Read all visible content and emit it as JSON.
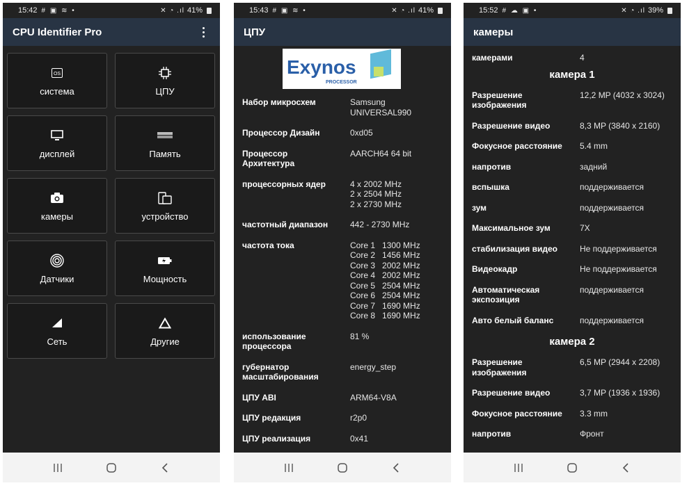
{
  "screen1": {
    "status": {
      "time": "15:42",
      "icons": "# ▣ ≋ •",
      "right_icons": "✕ ◔ .ıl",
      "battery": "41%"
    },
    "title": "CPU Identifier Pro",
    "tiles": [
      {
        "label": "система",
        "icon": "os-icon"
      },
      {
        "label": "ЦПУ",
        "icon": "cpu-icon"
      },
      {
        "label": "дисплей",
        "icon": "monitor-icon"
      },
      {
        "label": "Память",
        "icon": "memory-icon"
      },
      {
        "label": "камеры",
        "icon": "camera-icon"
      },
      {
        "label": "устройство",
        "icon": "device-icon"
      },
      {
        "label": "Датчики",
        "icon": "sensor-icon"
      },
      {
        "label": "Мощность",
        "icon": "battery-icon"
      },
      {
        "label": "Сеть",
        "icon": "signal-icon"
      },
      {
        "label": "Другие",
        "icon": "triangle-icon"
      }
    ]
  },
  "screen2": {
    "status": {
      "time": "15:43",
      "icons": "# ▣ ≋ •",
      "right_icons": "✕ ◔ .ıl",
      "battery": "41%"
    },
    "title": "ЦПУ",
    "logo": {
      "brand": "Exynos",
      "sub": "PROCESSOR"
    },
    "rows": [
      {
        "k": "Набор микросхем",
        "v": "Samsung\nUNIVERSAL990"
      },
      {
        "k": "Процессор Дизайн",
        "v": "0xd05"
      },
      {
        "k": "Процессор\nАрхитектура",
        "v": "AARCH64 64 bit"
      },
      {
        "k": "процессорных ядер",
        "v": "4 x 2002 MHz\n2 x 2504 MHz\n2 x 2730 MHz"
      },
      {
        "k": "частотный диапазон",
        "v": "442 - 2730 MHz"
      },
      {
        "k": "частота тока",
        "v": "Core 1   1300 MHz\nCore 2   1456 MHz\nCore 3   2002 MHz\nCore 4   2002 MHz\nCore 5   2504 MHz\nCore 6   2504 MHz\nCore 7   1690 MHz\nCore 8   1690 MHz"
      },
      {
        "k": "использование\nпроцессора",
        "v": "81 %"
      },
      {
        "k": "губернатор\nмасштабирования",
        "v": "energy_step"
      },
      {
        "k": "ЦПУ ABI",
        "v": "ARM64-V8A"
      },
      {
        "k": "ЦПУ редакция",
        "v": "r2p0"
      },
      {
        "k": "ЦПУ реализация",
        "v": "0x41"
      }
    ]
  },
  "screen3": {
    "status": {
      "time": "15:52",
      "icons": "# ☁ ▣ •",
      "right_icons": "✕ ◔ .ıl",
      "battery": "39%"
    },
    "title": "камеры",
    "count_row": {
      "k": "камерами",
      "v": "4"
    },
    "camera1_title": "камера 1",
    "camera1": [
      {
        "k": "Разрешение\nизображения",
        "v": "12,2 MP (4032 x 3024)"
      },
      {
        "k": "Разрешение видео",
        "v": "8,3 MP (3840 x 2160)"
      },
      {
        "k": "Фокусное расстояние",
        "v": "5.4 mm"
      },
      {
        "k": "напротив",
        "v": "задний"
      },
      {
        "k": "вспышка",
        "v": "поддерживается"
      },
      {
        "k": "зум",
        "v": "поддерживается"
      },
      {
        "k": "Максимальное зум",
        "v": "7X"
      },
      {
        "k": "стабилизация видео",
        "v": "Не поддерживается"
      },
      {
        "k": "Видеокадр",
        "v": "Не поддерживается"
      },
      {
        "k": "Автоматическая\nэкспозиция",
        "v": "поддерживается"
      },
      {
        "k": "Авто белый баланс",
        "v": "поддерживается"
      }
    ],
    "camera2_title": "камера 2",
    "camera2": [
      {
        "k": "Разрешение\nизображения",
        "v": "6,5 MP (2944 x 2208)"
      },
      {
        "k": "Разрешение видео",
        "v": "3,7 MP (1936 x 1936)"
      },
      {
        "k": "Фокусное расстояние",
        "v": "3.3 mm"
      },
      {
        "k": "напротив",
        "v": "Фронт"
      }
    ]
  }
}
